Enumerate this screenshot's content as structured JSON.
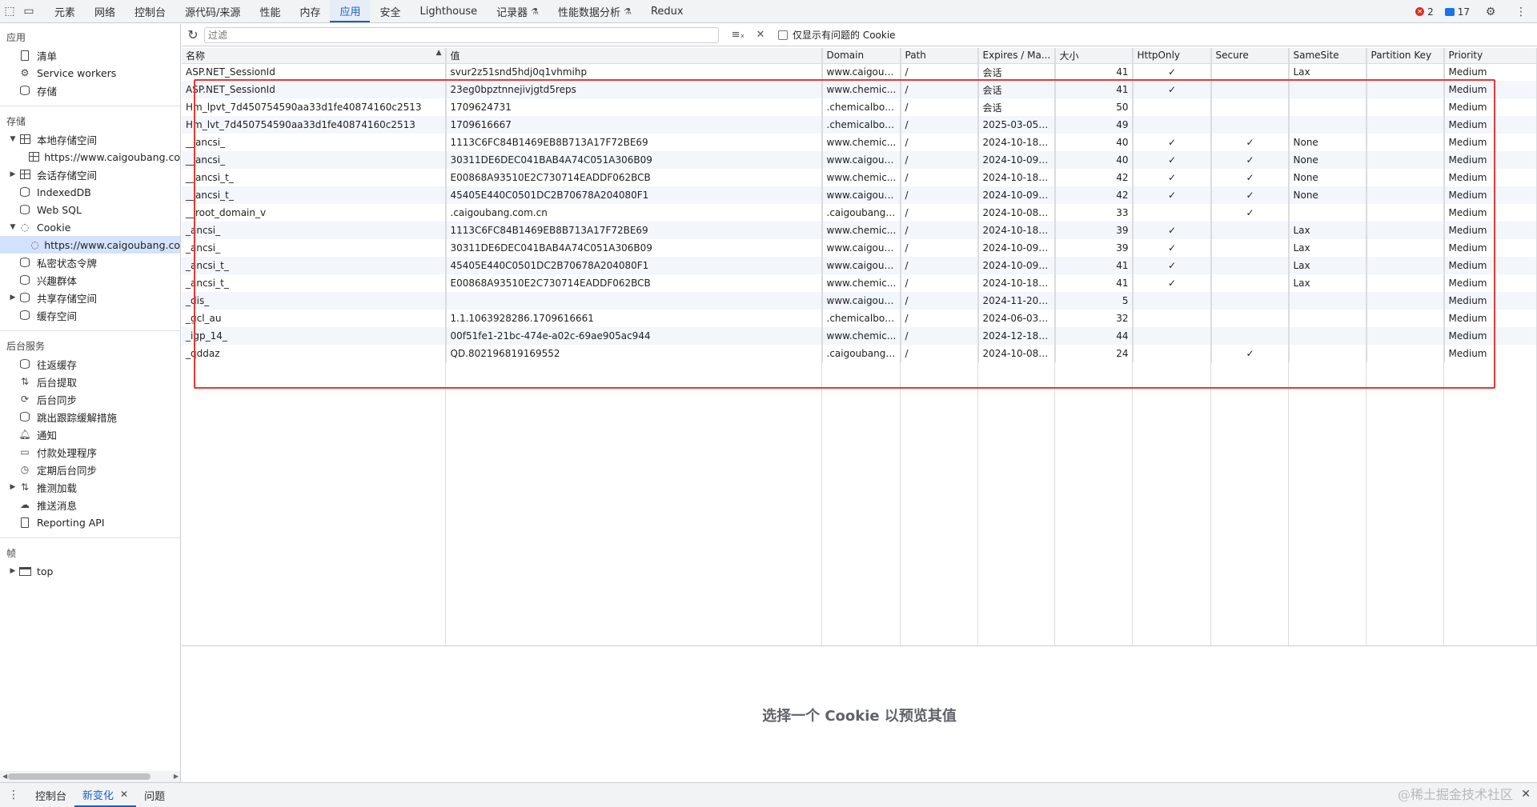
{
  "topbar": {
    "tabs": [
      {
        "label": "元素"
      },
      {
        "label": "网络"
      },
      {
        "label": "控制台"
      },
      {
        "label": "源代码/来源"
      },
      {
        "label": "性能"
      },
      {
        "label": "内存"
      },
      {
        "label": "应用"
      },
      {
        "label": "安全"
      },
      {
        "label": "Lighthouse"
      },
      {
        "label": "记录器"
      },
      {
        "label": "性能数据分析"
      },
      {
        "label": "Redux"
      }
    ],
    "active_tab": "应用",
    "error_count": "2",
    "message_count": "17"
  },
  "sidebar": {
    "app_title": "应用",
    "app_items": [
      {
        "label": "清单",
        "icon": "file-icon"
      },
      {
        "label": "Service workers",
        "icon": "gear-icon"
      },
      {
        "label": "存储",
        "icon": "database-icon"
      }
    ],
    "storage_title": "存储",
    "storage_items": [
      {
        "label": "本地存储空间",
        "icon": "grid-icon",
        "expanded": true,
        "indent": 0
      },
      {
        "label": "https://www.caigoubang.co",
        "icon": "grid-icon",
        "indent": 1
      },
      {
        "label": "会话存储空间",
        "icon": "grid-icon",
        "collapsed": true,
        "indent": 0
      },
      {
        "label": "IndexedDB",
        "icon": "database-icon",
        "indent": 0
      },
      {
        "label": "Web SQL",
        "icon": "database-icon",
        "indent": 0
      },
      {
        "label": "Cookie",
        "icon": "cookie-icon",
        "expanded": true,
        "indent": 0
      },
      {
        "label": "https://www.caigoubang.co",
        "icon": "cookie-icon",
        "indent": 1,
        "selected": true
      },
      {
        "label": "私密状态令牌",
        "icon": "database-icon",
        "indent": 0
      },
      {
        "label": "兴趣群体",
        "icon": "database-icon",
        "indent": 0
      },
      {
        "label": "共享存储空间",
        "icon": "database-icon",
        "collapsed": true,
        "indent": 0
      },
      {
        "label": "缓存空间",
        "icon": "database-icon",
        "indent": 0
      }
    ],
    "bg_title": "后台服务",
    "bg_items": [
      {
        "label": "往返缓存",
        "icon": "database-icon"
      },
      {
        "label": "后台提取",
        "icon": "arrows-updown-icon"
      },
      {
        "label": "后台同步",
        "icon": "sync-icon"
      },
      {
        "label": "跳出跟踪缓解措施",
        "icon": "database-icon"
      },
      {
        "label": "通知",
        "icon": "bell-icon"
      },
      {
        "label": "付款处理程序",
        "icon": "card-icon"
      },
      {
        "label": "定期后台同步",
        "icon": "clock-icon"
      },
      {
        "label": "推测加载",
        "icon": "arrows-updown-icon",
        "collapsed": true
      },
      {
        "label": "推送消息",
        "icon": "cloud-icon"
      },
      {
        "label": "Reporting API",
        "icon": "file-icon"
      }
    ],
    "frames_title": "帧",
    "frames_items": [
      {
        "label": "top",
        "icon": "frame-icon",
        "collapsed": true
      }
    ]
  },
  "toolbar": {
    "filter_placeholder": "过滤",
    "only_issues_label": "仅显示有问题的 Cookie"
  },
  "table": {
    "columns": [
      "名称",
      "值",
      "Domain",
      "Path",
      "Expires / Ma...",
      "大小",
      "HttpOnly",
      "Secure",
      "SameSite",
      "Partition Key",
      "Priority"
    ],
    "rows": [
      [
        "ASP.NET_SessionId",
        "svur2z51snd5hdj0q1vhmihp",
        "www.caigoub...",
        "/",
        "会话",
        "41",
        "✓",
        "",
        "Lax",
        "",
        "Medium"
      ],
      [
        "ASP.NET_SessionId",
        "23eg0bpztnnejivjgtd5reps",
        "www.chemic...",
        "/",
        "会话",
        "41",
        "✓",
        "",
        "",
        "",
        "Medium"
      ],
      [
        "Hm_lpvt_7d450754590aa33d1fe40874160c2513",
        "1709624731",
        ".chemicalboo...",
        "/",
        "会话",
        "50",
        "",
        "",
        "",
        "",
        "Medium"
      ],
      [
        "Hm_lvt_7d450754590aa33d1fe40874160c2513",
        "1709616667",
        ".chemicalboo...",
        "/",
        "2025-03-05T...",
        "49",
        "",
        "",
        "",
        "",
        "Medium"
      ],
      [
        "__ancsi_",
        "1113C6FC84B1469EB8B713A17F72BE69",
        "www.chemic...",
        "/",
        "2024-10-18T...",
        "40",
        "✓",
        "✓",
        "None",
        "",
        "Medium"
      ],
      [
        "__ancsi_",
        "30311DE6DEC041BAB4A74C051A306B09",
        "www.caigoub...",
        "/",
        "2024-10-09T...",
        "40",
        "✓",
        "✓",
        "None",
        "",
        "Medium"
      ],
      [
        "__ancsi_t_",
        "E00868A93510E2C730714EADDF062BCB",
        "www.chemic...",
        "/",
        "2024-10-18T...",
        "42",
        "✓",
        "✓",
        "None",
        "",
        "Medium"
      ],
      [
        "__ancsi_t_",
        "45405E440C0501DC2B70678A204080F1",
        "www.caigoub...",
        "/",
        "2024-10-09T...",
        "42",
        "✓",
        "✓",
        "None",
        "",
        "Medium"
      ],
      [
        "__root_domain_v",
        ".caigoubang.com.cn",
        ".caigoubang....",
        "/",
        "2024-10-08T...",
        "33",
        "",
        "✓",
        "",
        "",
        "Medium"
      ],
      [
        "_ancsi_",
        "1113C6FC84B1469EB8B713A17F72BE69",
        "www.chemic...",
        "/",
        "2024-10-18T...",
        "39",
        "✓",
        "",
        "Lax",
        "",
        "Medium"
      ],
      [
        "_ancsi_",
        "30311DE6DEC041BAB4A74C051A306B09",
        "www.caigoub...",
        "/",
        "2024-10-09T...",
        "39",
        "✓",
        "",
        "Lax",
        "",
        "Medium"
      ],
      [
        "_ancsi_t_",
        "45405E440C0501DC2B70678A204080F1",
        "www.caigoub...",
        "/",
        "2024-10-09T...",
        "41",
        "✓",
        "",
        "Lax",
        "",
        "Medium"
      ],
      [
        "_ancsi_t_",
        "E00868A93510E2C730714EADDF062BCB",
        "www.chemic...",
        "/",
        "2024-10-18T...",
        "41",
        "✓",
        "",
        "Lax",
        "",
        "Medium"
      ],
      [
        "_dis_",
        "",
        "www.caigoub...",
        "/",
        "2024-11-20T...",
        "5",
        "",
        "",
        "",
        "",
        "Medium"
      ],
      [
        "_gcl_au",
        "1.1.1063928286.1709616661",
        ".chemicalboo...",
        "/",
        "2024-06-03T...",
        "32",
        "",
        "",
        "",
        "",
        "Medium"
      ],
      [
        "_igp_14_",
        "00f51fe1-21bc-474e-a02c-69ae905ac944",
        "www.chemic...",
        "/",
        "2024-12-18T...",
        "44",
        "",
        "",
        "",
        "",
        "Medium"
      ],
      [
        "_qddaz",
        "QD.802196819169552",
        ".caigoubang....",
        "/",
        "2024-10-08T...",
        "24",
        "",
        "✓",
        "",
        "",
        "Medium"
      ]
    ]
  },
  "preview_text": "选择一个 Cookie 以预览其值",
  "drawer": {
    "tabs": [
      {
        "label": "控制台",
        "closable": false
      },
      {
        "label": "新变化",
        "closable": true
      },
      {
        "label": "问题",
        "closable": false
      }
    ],
    "active_tab": "新变化"
  },
  "watermark": "@稀土掘金技术社区",
  "colors": {
    "accent": "#1a5fc8",
    "highlight_box": "#e53935",
    "selected_bg": "#d3e3fd"
  }
}
